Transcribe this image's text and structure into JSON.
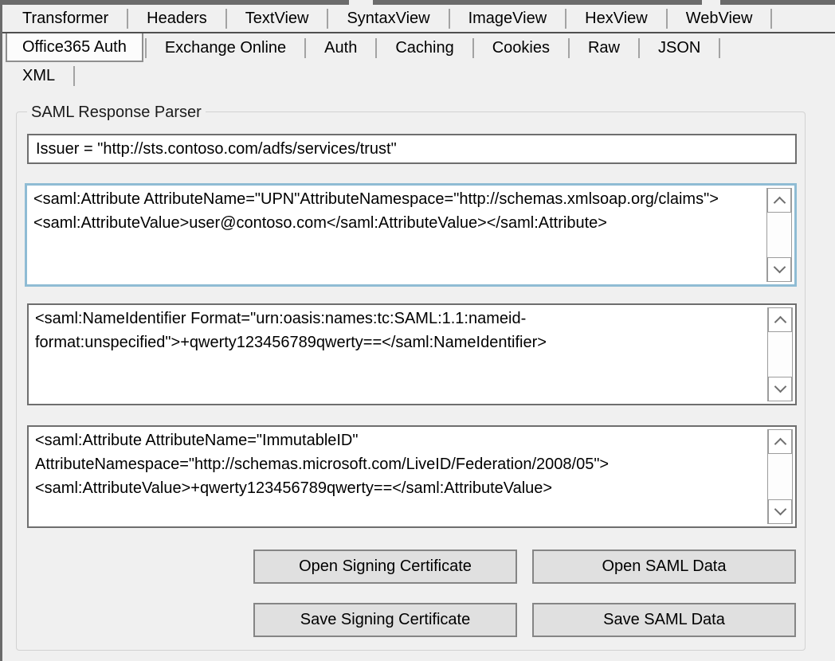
{
  "tabs": {
    "row1": [
      {
        "label": "Transformer"
      },
      {
        "label": "Headers"
      },
      {
        "label": "TextView"
      },
      {
        "label": "SyntaxView"
      },
      {
        "label": "ImageView"
      },
      {
        "label": "HexView"
      },
      {
        "label": "WebView"
      }
    ],
    "row2": [
      {
        "label": "Office365 Auth",
        "selected": true
      },
      {
        "label": "Exchange Online"
      },
      {
        "label": "Auth"
      },
      {
        "label": "Caching"
      },
      {
        "label": "Cookies"
      },
      {
        "label": "Raw"
      },
      {
        "label": "JSON"
      }
    ],
    "row3": [
      {
        "label": "XML"
      }
    ]
  },
  "saml_parser": {
    "group_title": "SAML Response Parser",
    "issuer_value": "Issuer = \"http://sts.contoso.com/adfs/services/trust\"",
    "upn_attribute": "<saml:Attribute AttributeName=\"UPN\"AttributeNamespace=\"http://schemas.xmlsoap.org/claims\"><saml:AttributeValue>user@contoso.com</saml:AttributeValue></saml:Attribute>",
    "name_identifier": "<saml:NameIdentifier Format=\"urn:oasis:names:tc:SAML:1.1:nameid-format:unspecified\">+qwerty123456789qwerty==</saml:NameIdentifier>",
    "immutable_id_attribute": "<saml:Attribute AttributeName=\"ImmutableID\" AttributeNamespace=\"http://schemas.microsoft.com/LiveID/Federation/2008/05\"><saml:AttributeValue>+qwerty123456789qwerty==</saml:AttributeValue>",
    "buttons": {
      "open_signing_certificate": "Open Signing Certificate",
      "open_saml_data": "Open SAML Data",
      "save_signing_certificate": "Save Signing Certificate",
      "save_saml_data": "Save SAML Data"
    }
  },
  "icons": {
    "scroll_up": "chevron-up-icon",
    "scroll_down": "chevron-down-icon"
  },
  "colors": {
    "focus_border": "#8fbcd4",
    "control_border": "#6e6e6e",
    "dark_edge": "#6b6b6b",
    "background": "#f0f0f0",
    "button_bg": "#e0e0e0"
  }
}
